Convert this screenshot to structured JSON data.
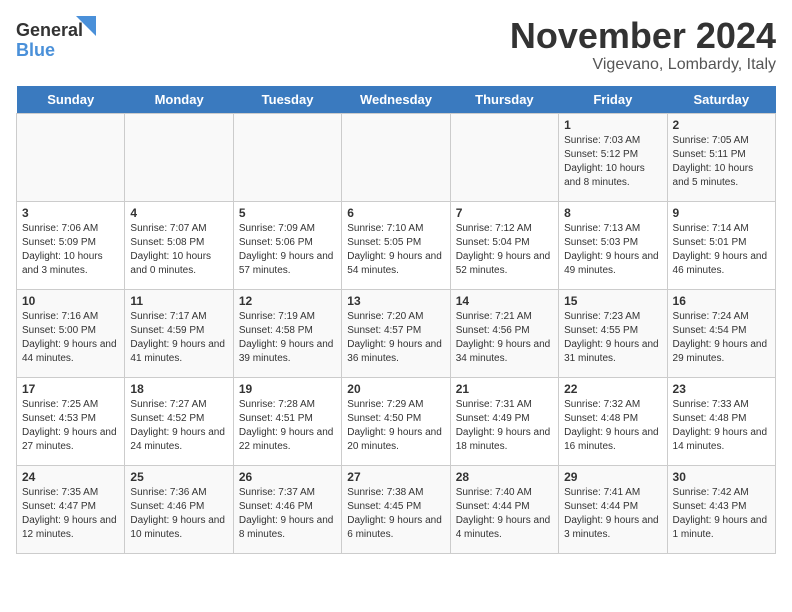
{
  "logo": {
    "general": "General",
    "blue": "Blue"
  },
  "title": "November 2024",
  "subtitle": "Vigevano, Lombardy, Italy",
  "days_of_week": [
    "Sunday",
    "Monday",
    "Tuesday",
    "Wednesday",
    "Thursday",
    "Friday",
    "Saturday"
  ],
  "weeks": [
    [
      {
        "day": "",
        "info": ""
      },
      {
        "day": "",
        "info": ""
      },
      {
        "day": "",
        "info": ""
      },
      {
        "day": "",
        "info": ""
      },
      {
        "day": "",
        "info": ""
      },
      {
        "day": "1",
        "info": "Sunrise: 7:03 AM\nSunset: 5:12 PM\nDaylight: 10 hours and 8 minutes."
      },
      {
        "day": "2",
        "info": "Sunrise: 7:05 AM\nSunset: 5:11 PM\nDaylight: 10 hours and 5 minutes."
      }
    ],
    [
      {
        "day": "3",
        "info": "Sunrise: 7:06 AM\nSunset: 5:09 PM\nDaylight: 10 hours and 3 minutes."
      },
      {
        "day": "4",
        "info": "Sunrise: 7:07 AM\nSunset: 5:08 PM\nDaylight: 10 hours and 0 minutes."
      },
      {
        "day": "5",
        "info": "Sunrise: 7:09 AM\nSunset: 5:06 PM\nDaylight: 9 hours and 57 minutes."
      },
      {
        "day": "6",
        "info": "Sunrise: 7:10 AM\nSunset: 5:05 PM\nDaylight: 9 hours and 54 minutes."
      },
      {
        "day": "7",
        "info": "Sunrise: 7:12 AM\nSunset: 5:04 PM\nDaylight: 9 hours and 52 minutes."
      },
      {
        "day": "8",
        "info": "Sunrise: 7:13 AM\nSunset: 5:03 PM\nDaylight: 9 hours and 49 minutes."
      },
      {
        "day": "9",
        "info": "Sunrise: 7:14 AM\nSunset: 5:01 PM\nDaylight: 9 hours and 46 minutes."
      }
    ],
    [
      {
        "day": "10",
        "info": "Sunrise: 7:16 AM\nSunset: 5:00 PM\nDaylight: 9 hours and 44 minutes."
      },
      {
        "day": "11",
        "info": "Sunrise: 7:17 AM\nSunset: 4:59 PM\nDaylight: 9 hours and 41 minutes."
      },
      {
        "day": "12",
        "info": "Sunrise: 7:19 AM\nSunset: 4:58 PM\nDaylight: 9 hours and 39 minutes."
      },
      {
        "day": "13",
        "info": "Sunrise: 7:20 AM\nSunset: 4:57 PM\nDaylight: 9 hours and 36 minutes."
      },
      {
        "day": "14",
        "info": "Sunrise: 7:21 AM\nSunset: 4:56 PM\nDaylight: 9 hours and 34 minutes."
      },
      {
        "day": "15",
        "info": "Sunrise: 7:23 AM\nSunset: 4:55 PM\nDaylight: 9 hours and 31 minutes."
      },
      {
        "day": "16",
        "info": "Sunrise: 7:24 AM\nSunset: 4:54 PM\nDaylight: 9 hours and 29 minutes."
      }
    ],
    [
      {
        "day": "17",
        "info": "Sunrise: 7:25 AM\nSunset: 4:53 PM\nDaylight: 9 hours and 27 minutes."
      },
      {
        "day": "18",
        "info": "Sunrise: 7:27 AM\nSunset: 4:52 PM\nDaylight: 9 hours and 24 minutes."
      },
      {
        "day": "19",
        "info": "Sunrise: 7:28 AM\nSunset: 4:51 PM\nDaylight: 9 hours and 22 minutes."
      },
      {
        "day": "20",
        "info": "Sunrise: 7:29 AM\nSunset: 4:50 PM\nDaylight: 9 hours and 20 minutes."
      },
      {
        "day": "21",
        "info": "Sunrise: 7:31 AM\nSunset: 4:49 PM\nDaylight: 9 hours and 18 minutes."
      },
      {
        "day": "22",
        "info": "Sunrise: 7:32 AM\nSunset: 4:48 PM\nDaylight: 9 hours and 16 minutes."
      },
      {
        "day": "23",
        "info": "Sunrise: 7:33 AM\nSunset: 4:48 PM\nDaylight: 9 hours and 14 minutes."
      }
    ],
    [
      {
        "day": "24",
        "info": "Sunrise: 7:35 AM\nSunset: 4:47 PM\nDaylight: 9 hours and 12 minutes."
      },
      {
        "day": "25",
        "info": "Sunrise: 7:36 AM\nSunset: 4:46 PM\nDaylight: 9 hours and 10 minutes."
      },
      {
        "day": "26",
        "info": "Sunrise: 7:37 AM\nSunset: 4:46 PM\nDaylight: 9 hours and 8 minutes."
      },
      {
        "day": "27",
        "info": "Sunrise: 7:38 AM\nSunset: 4:45 PM\nDaylight: 9 hours and 6 minutes."
      },
      {
        "day": "28",
        "info": "Sunrise: 7:40 AM\nSunset: 4:44 PM\nDaylight: 9 hours and 4 minutes."
      },
      {
        "day": "29",
        "info": "Sunrise: 7:41 AM\nSunset: 4:44 PM\nDaylight: 9 hours and 3 minutes."
      },
      {
        "day": "30",
        "info": "Sunrise: 7:42 AM\nSunset: 4:43 PM\nDaylight: 9 hours and 1 minute."
      }
    ]
  ]
}
